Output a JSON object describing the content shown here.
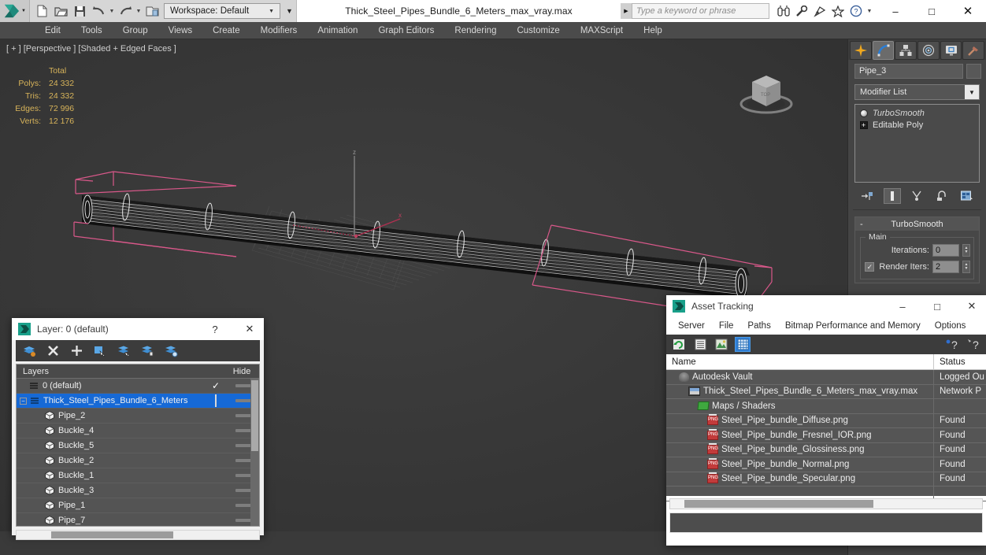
{
  "titlebar": {
    "logo_name": "3ds-max-logo",
    "workspace_label": "Workspace: Default",
    "document_title": "Thick_Steel_Pipes_Bundle_6_Meters_max_vray.max",
    "search_placeholder": "Type a keyword or phrase",
    "quick_access": [
      {
        "name": "new-file-icon",
        "label": "New"
      },
      {
        "name": "open-file-icon",
        "label": "Open"
      },
      {
        "name": "save-file-icon",
        "label": "Save"
      },
      {
        "name": "undo-icon",
        "label": "Undo"
      },
      {
        "name": "redo-icon",
        "label": "Redo"
      },
      {
        "name": "project-folder-icon",
        "label": "Set Project Folder"
      }
    ],
    "right_icons": [
      {
        "name": "binoculars-icon",
        "label": "Search Scene"
      },
      {
        "name": "wrench-icon",
        "label": "Customize"
      },
      {
        "name": "satellite-icon",
        "label": "Autodesk Services"
      },
      {
        "name": "star-icon",
        "label": "Favorites"
      },
      {
        "name": "help-icon",
        "label": "Help"
      }
    ],
    "window_controls": {
      "minimize": "–",
      "maximize": "□",
      "close": "✕"
    }
  },
  "menubar": {
    "items": [
      "Edit",
      "Tools",
      "Group",
      "Views",
      "Create",
      "Modifiers",
      "Animation",
      "Graph Editors",
      "Rendering",
      "Customize",
      "MAXScript",
      "Help"
    ]
  },
  "viewport": {
    "label": "[ + ] [Perspective ] [Shaded + Edged Faces ]",
    "stats": {
      "header": "Total",
      "rows": [
        {
          "label": "Polys:",
          "value": "24 332"
        },
        {
          "label": "Tris:",
          "value": "24 332"
        },
        {
          "label": "Edges:",
          "value": "72 996"
        },
        {
          "label": "Verts:",
          "value": "12 176"
        }
      ]
    },
    "viewcube_name": "viewcube",
    "scene_description": "Selected long steel pipe bundle wireframe with pink selection bracket gizmo"
  },
  "command_panel": {
    "tabs": [
      {
        "name": "create-tab",
        "label": "Create",
        "active": false
      },
      {
        "name": "modify-tab",
        "label": "Modify",
        "active": true
      },
      {
        "name": "hierarchy-tab",
        "label": "Hierarchy",
        "active": false
      },
      {
        "name": "motion-tab",
        "label": "Motion",
        "active": false
      },
      {
        "name": "display-tab",
        "label": "Display",
        "active": false
      },
      {
        "name": "utilities-tab",
        "label": "Utilities",
        "active": false
      }
    ],
    "object_name": "Pipe_3",
    "modifier_list_label": "Modifier List",
    "stack": [
      {
        "label": "TurboSmooth",
        "icon": "lightbulb-icon",
        "italic": true
      },
      {
        "label": "Editable Poly",
        "icon": "plus-box-icon",
        "italic": false
      }
    ],
    "stack_tools": [
      {
        "name": "pin-stack-icon"
      },
      {
        "name": "show-end-result-icon"
      },
      {
        "name": "make-unique-icon"
      },
      {
        "name": "remove-modifier-icon"
      },
      {
        "name": "configure-modifier-sets-icon"
      }
    ],
    "rollout": {
      "title": "TurboSmooth",
      "collapse_glyph": "-",
      "group_title": "Main",
      "iterations_label": "Iterations:",
      "iterations_value": "0",
      "render_iters_label": "Render Iters:",
      "render_iters_value": "2",
      "render_iters_checked": true
    }
  },
  "layer_dialog": {
    "title": "Layer: 0 (default)",
    "help_glyph": "?",
    "close_glyph": "✕",
    "toolbar": [
      {
        "name": "create-new-layer-icon"
      },
      {
        "name": "delete-layer-icon"
      },
      {
        "name": "add-layer-icon"
      },
      {
        "name": "select-objects-in-layer-icon"
      },
      {
        "name": "select-highlighted-objects-icon"
      },
      {
        "name": "highlight-selected-objects-icon"
      },
      {
        "name": "add-selected-to-layer-icon"
      }
    ],
    "columns": {
      "name": "Layers",
      "hide": "Hide"
    },
    "rows": [
      {
        "name": "0 (default)",
        "indent": 1,
        "selected": false,
        "check": "✓",
        "has_expander": false
      },
      {
        "name": "Thick_Steel_Pipes_Bundle_6_Meters",
        "indent": 0,
        "selected": true,
        "check": "",
        "has_expander": true
      },
      {
        "name": "Pipe_2",
        "indent": 2,
        "selected": false,
        "check": "",
        "has_expander": false
      },
      {
        "name": "Buckle_4",
        "indent": 2,
        "selected": false,
        "check": "",
        "has_expander": false
      },
      {
        "name": "Buckle_5",
        "indent": 2,
        "selected": false,
        "check": "",
        "has_expander": false
      },
      {
        "name": "Buckle_2",
        "indent": 2,
        "selected": false,
        "check": "",
        "has_expander": false
      },
      {
        "name": "Buckle_1",
        "indent": 2,
        "selected": false,
        "check": "",
        "has_expander": false
      },
      {
        "name": "Buckle_3",
        "indent": 2,
        "selected": false,
        "check": "",
        "has_expander": false
      },
      {
        "name": "Pipe_1",
        "indent": 2,
        "selected": false,
        "check": "",
        "has_expander": false
      },
      {
        "name": "Pipe_7",
        "indent": 2,
        "selected": false,
        "check": "",
        "has_expander": false
      }
    ]
  },
  "asset_dialog": {
    "title": "Asset Tracking",
    "window_controls": {
      "minimize": "–",
      "maximize": "□",
      "close": "✕"
    },
    "menus": [
      "Server",
      "File",
      "Paths",
      "Bitmap Performance and Memory",
      "Options"
    ],
    "toolbar": [
      {
        "name": "refresh-icon",
        "active": false
      },
      {
        "name": "list-view-icon",
        "active": false
      },
      {
        "name": "thumbnail-view-icon",
        "active": false
      },
      {
        "name": "grid-view-icon",
        "active": true
      }
    ],
    "toolbar_right": [
      {
        "name": "help-question-icon"
      },
      {
        "name": "context-help-icon"
      }
    ],
    "columns": {
      "name": "Name",
      "status": "Status"
    },
    "rows": [
      {
        "name": "Autodesk Vault",
        "status": "Logged Ou",
        "icon": "vault-icon",
        "indent": 1
      },
      {
        "name": "Thick_Steel_Pipes_Bundle_6_Meters_max_vray.max",
        "status": "Network P",
        "icon": "max-file-icon",
        "indent": 2
      },
      {
        "name": "Maps / Shaders",
        "status": "",
        "icon": "maps-folder-icon",
        "indent": 3
      },
      {
        "name": "Steel_Pipe_bundle_Diffuse.png",
        "status": "Found",
        "icon": "png-file-icon",
        "indent": 4
      },
      {
        "name": "Steel_Pipe_bundle_Fresnel_IOR.png",
        "status": "Found",
        "icon": "png-file-icon",
        "indent": 4
      },
      {
        "name": "Steel_Pipe_bundle_Glossiness.png",
        "status": "Found",
        "icon": "png-file-icon",
        "indent": 4
      },
      {
        "name": "Steel_Pipe_bundle_Normal.png",
        "status": "Found",
        "icon": "png-file-icon",
        "indent": 4
      },
      {
        "name": "Steel_Pipe_bundle_Specular.png",
        "status": "Found",
        "icon": "png-file-icon",
        "indent": 4
      }
    ]
  },
  "colors": {
    "accent_blue": "#1669d6",
    "panel_gray": "#444444",
    "viewport_bg": "#393939",
    "stats_gold": "#d8b45a",
    "selection_pink": "#d94f7e"
  }
}
